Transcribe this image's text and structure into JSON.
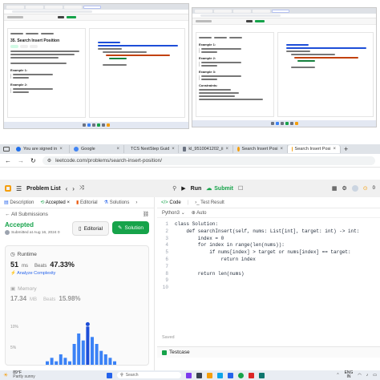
{
  "tabs": [
    {
      "label": "You are signed in",
      "icon": "edge-profile-icon",
      "color": "#1f6feb"
    },
    {
      "label": "Google",
      "icon": "google-icon",
      "color": "#4285f4"
    },
    {
      "label": "TCS NextStep Guid",
      "icon": "tcs-icon",
      "color": "#1a73e8"
    },
    {
      "label": "kl_9510041202_ii",
      "icon": "document-icon",
      "color": "#6b7280"
    },
    {
      "label": "Search Insert Posi",
      "icon": "leetcode-icon",
      "color": "#f59e0b"
    },
    {
      "label": "Search Insert Posi",
      "icon": "leetcode-icon",
      "color": "#f59e0b",
      "active": true
    }
  ],
  "url": "leetcode.com/problems/search-insert-position/",
  "header": {
    "problem_list": "Problem List",
    "run": "Run",
    "submit": "Submit",
    "count": "0"
  },
  "left_tabs": [
    "Description",
    "Accepted",
    "Editorial",
    "Solutions"
  ],
  "submission": {
    "all_link": "All Submissions",
    "status": "Accepted",
    "submitted": "Submitted at Aug 16, 2024 0",
    "editorial_btn": "Editorial",
    "solution_btn": "Solution",
    "runtime_label": "Runtime",
    "runtime_value": "51",
    "runtime_unit": "ms",
    "beats_label": "Beats",
    "beats_value": "47.33%",
    "analyze": "Analyze Complexity",
    "memory_label": "Memory",
    "memory_value": "17.34",
    "memory_unit": "MB",
    "memory_beats": "15.98%",
    "axis_top": "10%",
    "axis_mid": "5%"
  },
  "editor": {
    "tab_code": "Code",
    "tab_result": "Test Result",
    "language": "Python3",
    "mode": "Auto",
    "saved": "Saved",
    "testcase": "Testcase",
    "line_numbers": [
      "1",
      "2",
      "3",
      "4",
      "5",
      "6",
      "7",
      "8",
      "9",
      "10"
    ],
    "lines": [
      "class Solution:",
      "    def searchInsert(self, nums: List[int], target: int) -> int:",
      "        index = 0",
      "        for index in range(len(nums)):",
      "            if nums[index] > target or nums[index] == target:",
      "                return index",
      "",
      "        return len(nums)",
      "",
      ""
    ]
  },
  "taskbar": {
    "weather_temp": "89°F",
    "weather_desc": "Partly sunny",
    "search": "Search",
    "lang": "ENG",
    "region": "IN"
  },
  "chart_data": {
    "type": "bar",
    "values": [
      1,
      2,
      1,
      3,
      2,
      1,
      6,
      9,
      7,
      11,
      8,
      6,
      4,
      3,
      2,
      1
    ],
    "ylim": [
      0,
      12
    ],
    "highlight_index": 9
  },
  "thumb_left": {
    "title": "35. Search Insert Position",
    "example1": "Example 1:",
    "example2": "Example 2:"
  },
  "thumb_right": {
    "example1": "Example 1:",
    "example2": "Example 2:",
    "example3": "Example 3:",
    "constraints": "Constraints:"
  }
}
